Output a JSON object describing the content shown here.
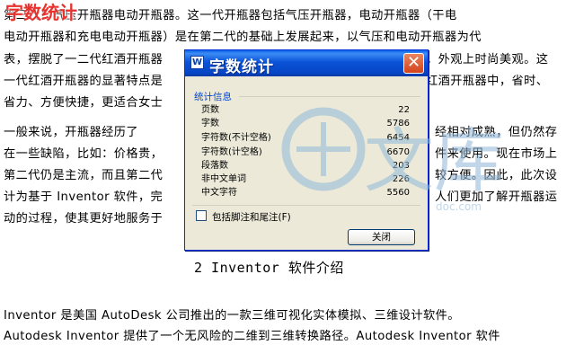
{
  "overlay_title": "字数统计",
  "document": {
    "paragraph1": [
      "        第三代：气压开瓶器电动开瓶器。这一代开瓶器包括气压开瓶器，电动开瓶器（干电",
      "电动开瓶器和充电电动开瓶器）是在第二代的基础上发展起来，以气压和电动开瓶器为代",
      "表，摆脱了一二代红酒开瓶器",
      "一代红酒开瓶器的显著特点是",
      "省力、方便快捷，更适合女士"
    ],
    "paragraph1_right": [
      "。外观上时尚美观。这",
      "红酒开瓶器中，省时、"
    ],
    "paragraph2_left": [
      "        一般来说，开瓶器经历了",
      "在一些缺陷，比如：价格贵，",
      "第二代仍是主流，而且第二代",
      "计为基于 Inventor 软件，完",
      "动的过程，使其更好地服务于"
    ],
    "paragraph2_right": [
      "经相对成熟，但仍然存",
      "件来使用。现在市场上",
      "较方便。因此，此次设",
      "人们更加了解开瓶器运"
    ],
    "heading2": "2 Inventor 软件介绍",
    "paragraph3": [
      "        Inventor 是美国 AutoDesk 公司推出的一款三维可视化实体模拟、三维设计软件。",
      "Autodesk Inventor 提供了一个无风险的二维到三维转换路径。Autodesk Inventor 软件"
    ]
  },
  "dialog": {
    "title": "字数统计",
    "close_symbol": "✕",
    "group_label": "统计信息",
    "stats": [
      {
        "label": "页数",
        "value": "22"
      },
      {
        "label": "字数",
        "value": "5786"
      },
      {
        "label": "字符数(不计空格)",
        "value": "6454"
      },
      {
        "label": "字符数(计空格)",
        "value": "6670"
      },
      {
        "label": "段落数",
        "value": "203"
      },
      {
        "label": "非中文单词",
        "value": "226"
      },
      {
        "label": "中文字符",
        "value": "5560"
      }
    ],
    "checkbox_label": "包括脚注和尾注(F)",
    "checkbox_checked": false,
    "close_button": "关闭"
  },
  "watermark": {
    "text": "文库",
    "url_fragment": "doc.com"
  },
  "colors": {
    "title_bar": "#0a53d8",
    "close_x": "#d4421c",
    "overlay_title": "#e8322e",
    "watermark": "#8fb8d8"
  }
}
